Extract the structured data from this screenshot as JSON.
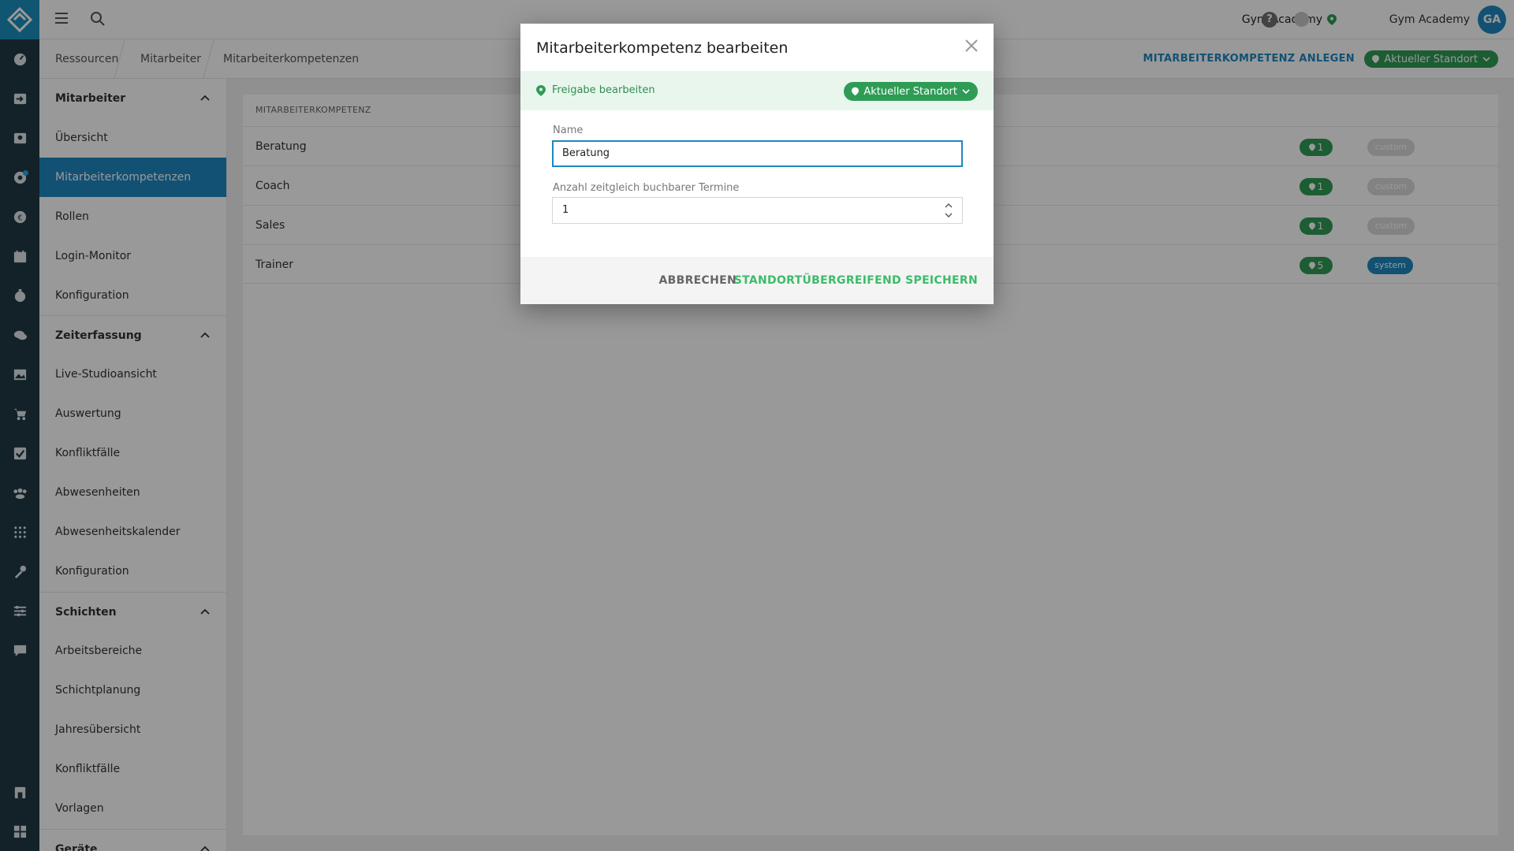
{
  "topbar": {
    "studio_name": "Gym Academy",
    "help_symbol": "?",
    "user_name": "Gym Academy",
    "avatar_initials": "GA"
  },
  "breadcrumb": [
    "Ressourcen",
    "Mitarbeiter",
    "Mitarbeiterkompetenzen"
  ],
  "actions": {
    "create_label": "MITARBEITERKOMPETENZ ANLEGEN",
    "location_label": "Aktueller Standort"
  },
  "sidebar": {
    "sections": [
      {
        "title": "Mitarbeiter",
        "items": [
          "Übersicht",
          "Mitarbeiterkompetenzen",
          "Rollen",
          "Login-Monitor",
          "Konfiguration"
        ]
      },
      {
        "title": "Zeiterfassung",
        "items": [
          "Live-Studioansicht",
          "Auswertung",
          "Konfliktfälle",
          "Abwesenheiten",
          "Abwesenheitskalender",
          "Konfiguration"
        ]
      },
      {
        "title": "Schichten",
        "items": [
          "Arbeitsbereiche",
          "Schichtplanung",
          "Jahresübersicht",
          "Konfliktfälle",
          "Vorlagen"
        ]
      },
      {
        "title": "Geräte",
        "items": []
      }
    ],
    "active_item": "Mitarbeiterkompetenzen"
  },
  "table": {
    "header": "MITARBEITERKOMPETENZ",
    "rows": [
      {
        "name": "Beratung",
        "locations": "1",
        "type": "custom"
      },
      {
        "name": "Coach",
        "locations": "1",
        "type": "custom"
      },
      {
        "name": "Sales",
        "locations": "1",
        "type": "custom"
      },
      {
        "name": "Trainer",
        "locations": "5",
        "type": "system"
      }
    ]
  },
  "modal": {
    "title": "Mitarbeiterkompetenz bearbeiten",
    "freigabe_label": "Freigabe bearbeiten",
    "location_label": "Aktueller Standort",
    "name_label": "Name",
    "name_value": "Beratung",
    "count_label": "Anzahl zeitgleich buchbarer Termine",
    "count_value": "1",
    "cancel_label": "ABBRECHEN",
    "save_label": "STANDORTÜBERGREIFEND SPEICHERN"
  },
  "colors": {
    "accent": "#1e88c2",
    "rail": "#203a45",
    "success": "#2f9c56",
    "save": "#3dbb6a"
  }
}
